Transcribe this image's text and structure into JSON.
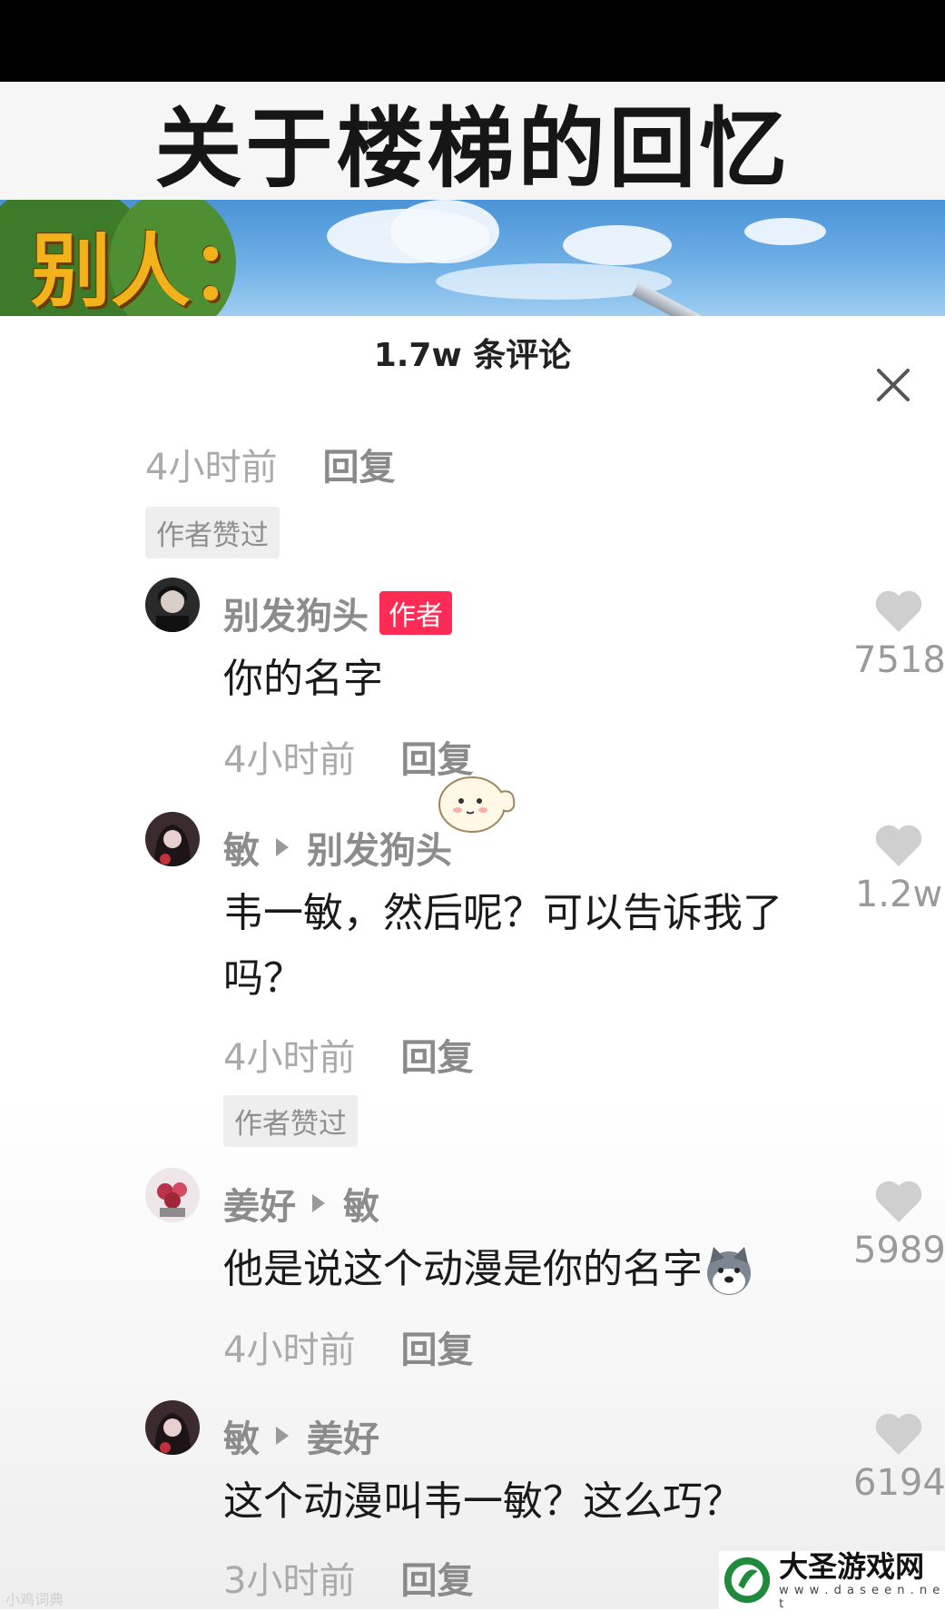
{
  "video": {
    "title": "关于楼梯的回忆",
    "scene_caption": "别人："
  },
  "comments_panel": {
    "title": "1.7w 条评论",
    "close_icon": "close-icon",
    "reply_label": "回复",
    "author_liked_label": "作者赞过",
    "author_badge": "作者",
    "top_partial": {
      "time": "4小时前"
    },
    "comments": [
      {
        "user": "别发狗头",
        "content": "你的名字",
        "time": "4小时前",
        "likes": "7518"
      },
      {
        "user": "敏",
        "reply_to": "别发狗头",
        "content": "韦一敏，然后呢？可以告诉我了吗？",
        "time": "4小时前",
        "likes": "1.2w"
      },
      {
        "user": "姜好",
        "reply_to": "敏",
        "content": "他是说这个动漫是你的名字",
        "time": "4小时前",
        "likes": "5989"
      },
      {
        "user": "敏",
        "reply_to": "姜好",
        "content": "这个动漫叫韦一敏？这么巧？",
        "time": "3小时前",
        "likes": "6194"
      }
    ]
  },
  "watermarks": {
    "left": "小鸡词典",
    "right_name": "大圣游戏网",
    "right_url": "w w w . d a s e e n . n e t"
  },
  "colors": {
    "accent": "#fe2c55",
    "caption": "#f2b21c"
  }
}
